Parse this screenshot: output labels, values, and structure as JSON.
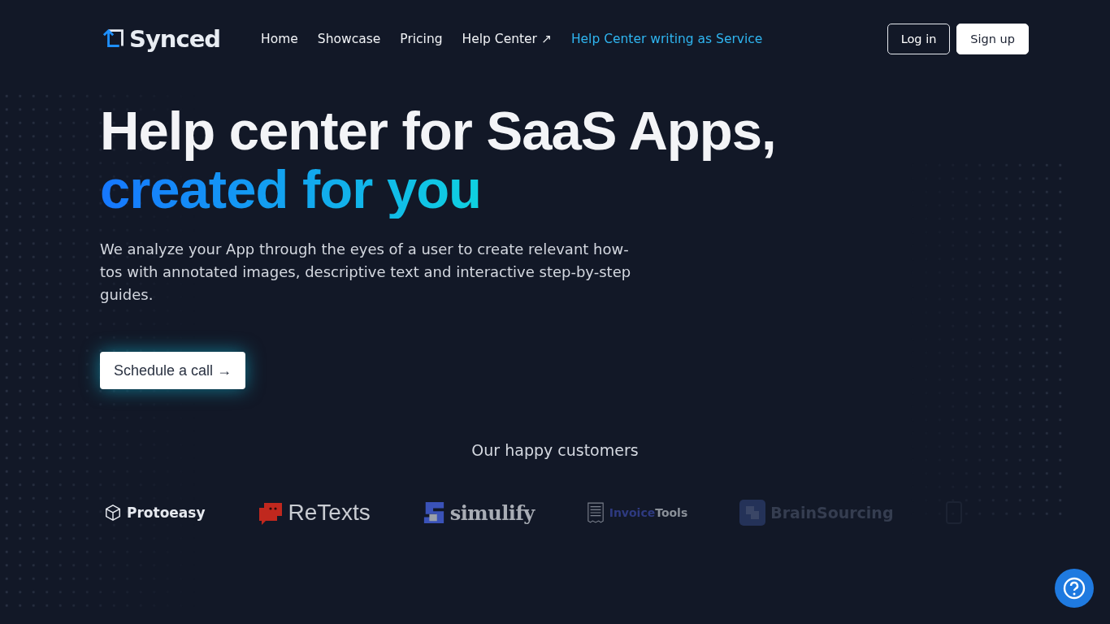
{
  "brand": {
    "name": "Synced"
  },
  "nav": [
    {
      "label": "Home",
      "kind": "plain"
    },
    {
      "label": "Showcase",
      "kind": "plain"
    },
    {
      "label": "Pricing",
      "kind": "plain"
    },
    {
      "label": "Help Center ↗",
      "kind": "plain"
    },
    {
      "label": "Help Center writing as Service",
      "kind": "highlight"
    }
  ],
  "auth": [
    {
      "label": "Log in",
      "kind": "outline"
    },
    {
      "label": "Sign up",
      "kind": "solid"
    }
  ],
  "hero": {
    "title": "Help center for SaaS Apps,",
    "title_accent": "created for you",
    "description": "We analyze your App through the eyes of a user to create relevant how-tos with annotated images, descriptive text and interactive step-by-step guides.",
    "cta": "Schedule a call →"
  },
  "customers": {
    "heading": "Our happy customers",
    "logos": [
      {
        "kind": "protoeasy",
        "text": "Protoeasy"
      },
      {
        "kind": "retexts",
        "text": "ReTexts"
      },
      {
        "kind": "simulify",
        "text": "simulify"
      },
      {
        "kind": "invoicetools",
        "text_accent": "Invoice",
        "text": "Tools"
      },
      {
        "kind": "brainsourcing",
        "text": "BrainSourcing"
      },
      {
        "kind": "faded"
      }
    ]
  }
}
